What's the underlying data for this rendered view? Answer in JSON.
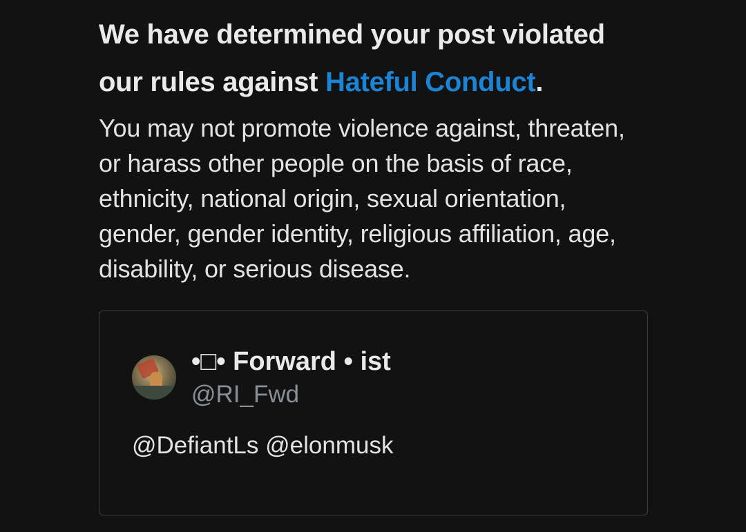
{
  "notice": {
    "headline_prefix": "We have determined your post violated our rules against ",
    "policy_link": "Hateful Conduct",
    "headline_suffix": ".",
    "description": "You may not promote violence against, threaten, or harass other people on the basis of race, ethnicity, national origin, sexual orientation, gender, gender identity, religious affiliation, age, disability, or serious disease."
  },
  "tweet": {
    "avatar_icon": "profile-avatar-image",
    "display_name": "•□• Forward • ist",
    "handle": "@RI_Fwd",
    "text": "@DefiantLs @elonmusk"
  },
  "colors": {
    "background": "#121213",
    "link": "#1d84d4",
    "text": "#e9eaec",
    "muted": "#8a9097",
    "border": "#3c3f44"
  }
}
